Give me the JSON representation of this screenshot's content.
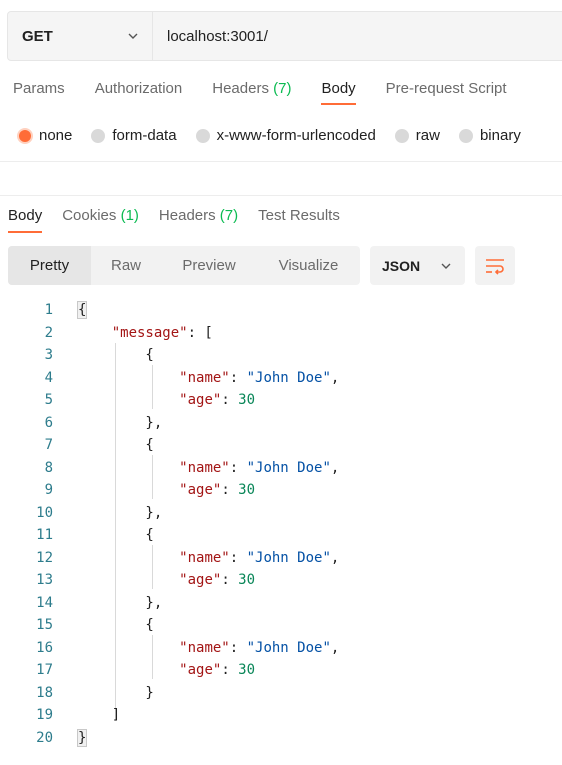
{
  "request": {
    "method": "GET",
    "url": "localhost:3001/",
    "tabs": [
      {
        "label": "Params",
        "count": ""
      },
      {
        "label": "Authorization",
        "count": ""
      },
      {
        "label": "Headers",
        "count": "(7)"
      },
      {
        "label": "Body",
        "count": ""
      },
      {
        "label": "Pre-request Script",
        "count": ""
      }
    ],
    "active_tab": "Body",
    "body_types": [
      "none",
      "form-data",
      "x-www-form-urlencoded",
      "raw",
      "binary"
    ],
    "selected_body_type": "none"
  },
  "response": {
    "tabs": [
      {
        "label": "Body",
        "count": ""
      },
      {
        "label": "Cookies",
        "count": "(1)"
      },
      {
        "label": "Headers",
        "count": "(7)"
      },
      {
        "label": "Test Results",
        "count": ""
      }
    ],
    "view_modes": [
      "Pretty",
      "Raw",
      "Preview",
      "Visualize"
    ],
    "active_view": "Pretty",
    "format": "JSON"
  },
  "code_lines": [
    {
      "n": "1",
      "text": "{"
    },
    {
      "n": "2",
      "text": "    \"message\": ["
    },
    {
      "n": "3",
      "text": "        {"
    },
    {
      "n": "4",
      "text": "            \"name\": \"John Doe\","
    },
    {
      "n": "5",
      "text": "            \"age\": 30"
    },
    {
      "n": "6",
      "text": "        },"
    },
    {
      "n": "7",
      "text": "        {"
    },
    {
      "n": "8",
      "text": "            \"name\": \"John Doe\","
    },
    {
      "n": "9",
      "text": "            \"age\": 30"
    },
    {
      "n": "10",
      "text": "        },"
    },
    {
      "n": "11",
      "text": "        {"
    },
    {
      "n": "12",
      "text": "            \"name\": \"John Doe\","
    },
    {
      "n": "13",
      "text": "            \"age\": 30"
    },
    {
      "n": "14",
      "text": "        },"
    },
    {
      "n": "15",
      "text": "        {"
    },
    {
      "n": "16",
      "text": "            \"name\": \"John Doe\","
    },
    {
      "n": "17",
      "text": "            \"age\": 30"
    },
    {
      "n": "18",
      "text": "        }"
    },
    {
      "n": "19",
      "text": "    ]"
    },
    {
      "n": "20",
      "text": "}"
    }
  ],
  "colors": {
    "accent": "#ff6c37",
    "count": "#0cbb52",
    "key": "#a31515",
    "string": "#0451a5",
    "number": "#098658"
  }
}
